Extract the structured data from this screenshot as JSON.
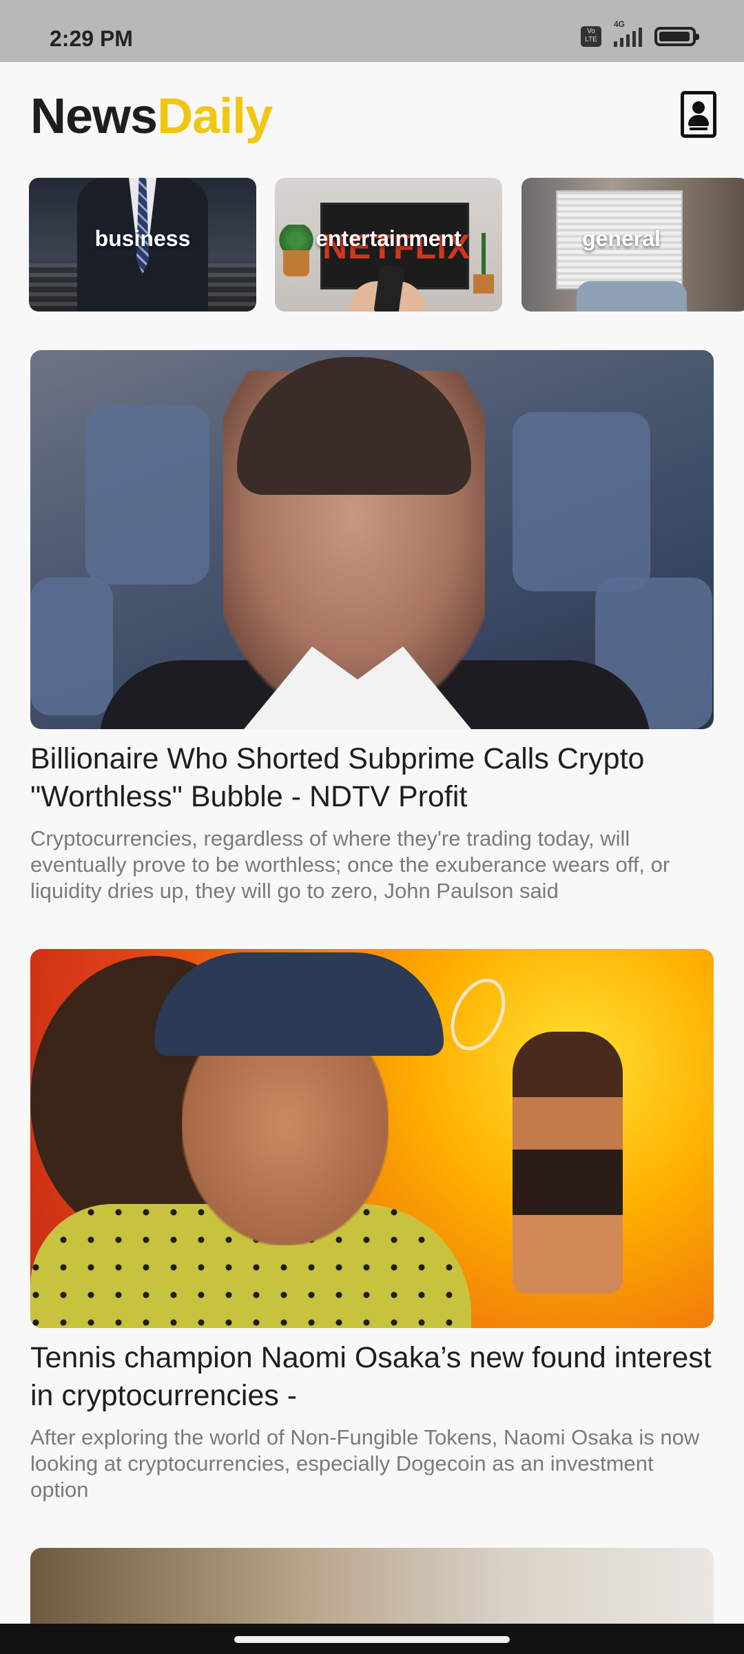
{
  "status_bar": {
    "time": "2:29 PM",
    "volte_label": "Vo LTE",
    "network_type": "4G",
    "battery_level_percent": 100
  },
  "app_bar": {
    "logo_part1": "News",
    "logo_part2": "Daily",
    "logo_part1_color": "#1e1e1e",
    "logo_part2_color": "#f2c511",
    "profile_icon": "contact-card-icon"
  },
  "categories": [
    {
      "label": "business"
    },
    {
      "label": "entertainment"
    },
    {
      "label": "general"
    }
  ],
  "entertainment_tv_text": "NETFLIX",
  "articles": [
    {
      "title": "Billionaire Who Shorted Subprime Calls Crypto \"Worthless\" Bubble - NDTV Profit",
      "description": "Cryptocurrencies, regardless of where they're trading today, will eventually prove to be worthless; once the exuberance wears off, or liquidity dries up, they will go to zero, John Paulson said"
    },
    {
      "title": "Tennis champion Naomi Osaka’s new found interest in cryptocurrencies -",
      "description": "After exploring the world of Non-Fungible Tokens, Naomi Osaka is now looking at cryptocurrencies, especially Dogecoin as an investment option"
    }
  ]
}
